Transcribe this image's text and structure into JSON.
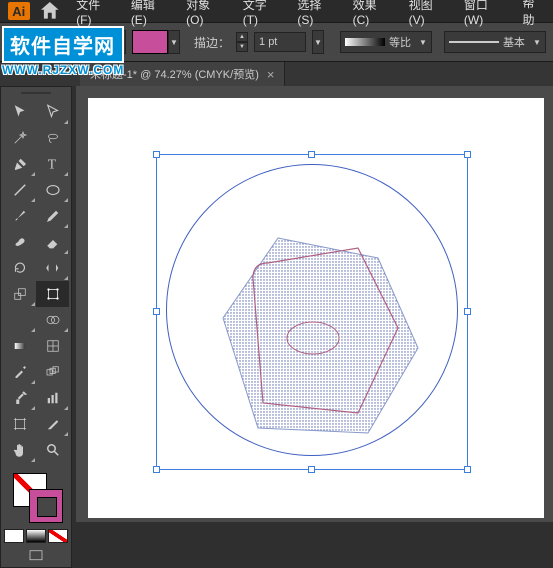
{
  "app_logo": "Ai",
  "menubar": {
    "items": [
      "文件(F)",
      "编辑(E)",
      "对象(O)",
      "文字(T)",
      "选择(S)",
      "效果(C)",
      "视图(V)",
      "窗口(W)",
      "帮助"
    ]
  },
  "controlbar": {
    "stroke_label": "描边：",
    "stroke_value": "1 pt",
    "combo1": "等比",
    "combo2": "基本"
  },
  "doc_tab": {
    "title": "未标题-1* @ 74.27% (CMYK/预览)",
    "close": "×"
  },
  "watermark": {
    "top": "软件自学网",
    "bottom": "WWW.RJZXW.COM"
  }
}
